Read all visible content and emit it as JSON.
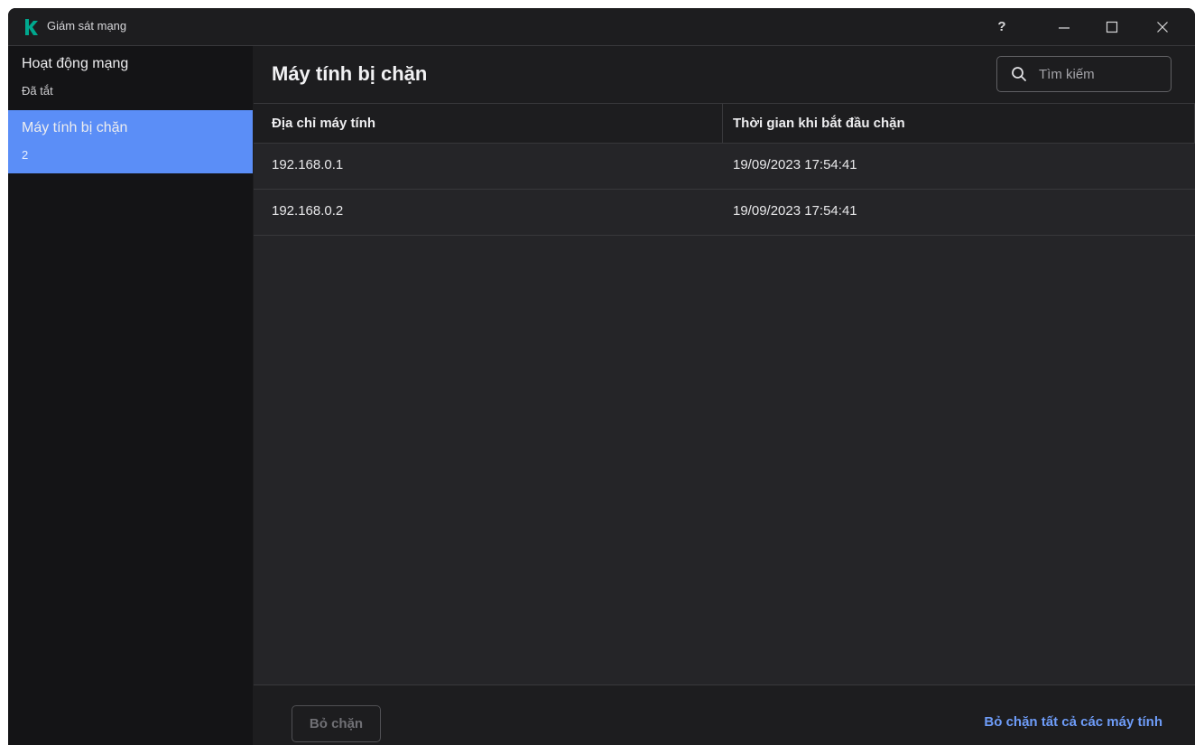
{
  "window": {
    "title": "Giám sát mạng",
    "help_label": "?"
  },
  "colors": {
    "accent": "#5b8ef7",
    "link": "#6e9cf8",
    "logo": "#00a88e",
    "background": "#1d1d1f"
  },
  "sidebar": {
    "items": [
      {
        "label": "Hoạt động mạng",
        "sub": "Đã tắt",
        "active": false
      },
      {
        "label": "Máy tính bị chặn",
        "sub": "2",
        "active": true
      }
    ]
  },
  "main": {
    "title": "Máy tính bị chặn",
    "search": {
      "placeholder": "Tìm kiếm",
      "value": ""
    },
    "table": {
      "columns": [
        "Địa chỉ máy tính",
        "Thời gian khi bắt đầu chặn"
      ],
      "rows": [
        [
          "192.168.0.1",
          "19/09/2023 17:54:41"
        ],
        [
          "192.168.0.2",
          "19/09/2023 17:54:41"
        ]
      ]
    }
  },
  "footer": {
    "unblock_label": "Bỏ chặn",
    "unblock_all_label": "Bỏ chặn tất cả các máy tính"
  }
}
